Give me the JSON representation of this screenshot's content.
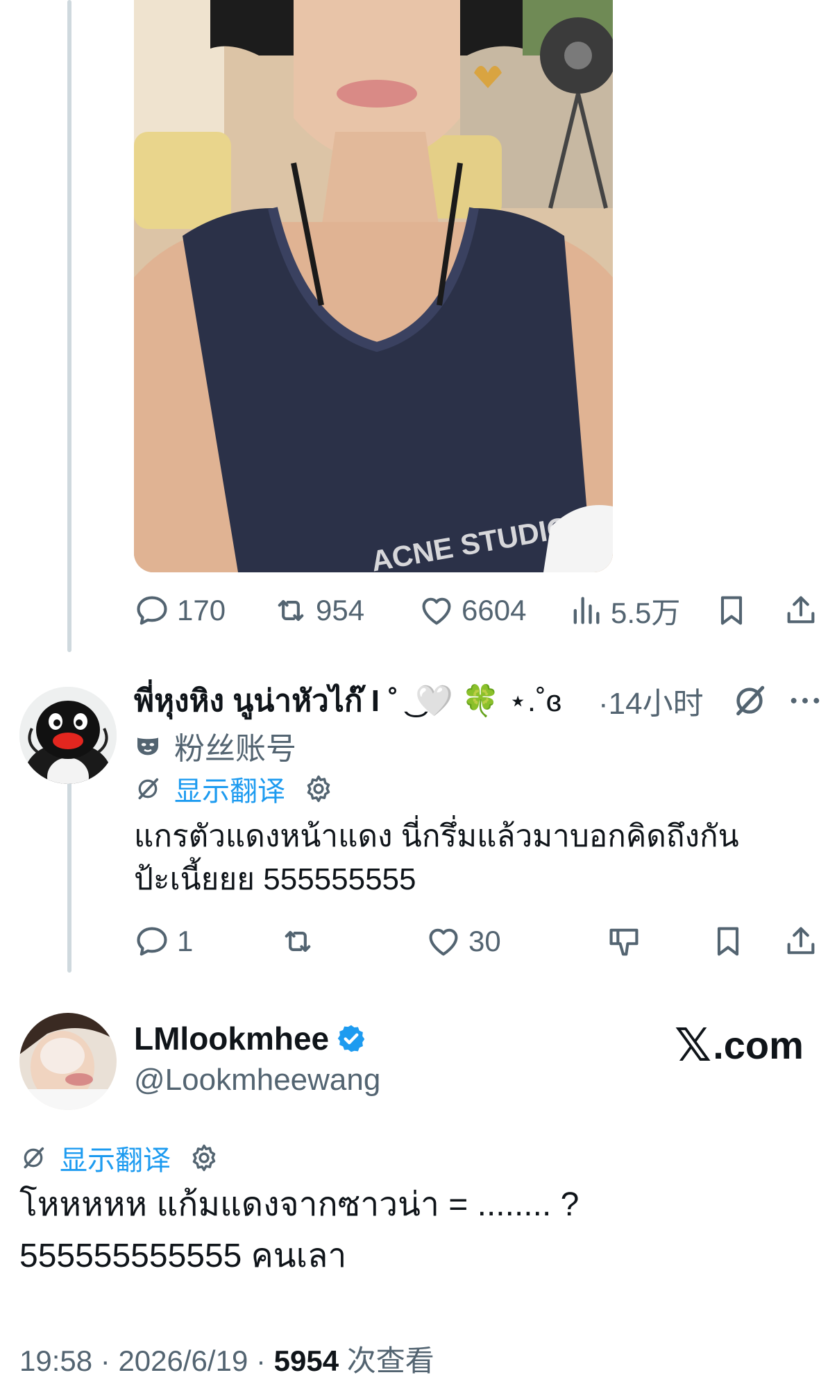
{
  "photo": {
    "shirt_print": "ACNE STUDIOS"
  },
  "first_tweet_actions": {
    "reply_count": "170",
    "retweet_count": "954",
    "like_count": "6604",
    "view_count": "5.5万"
  },
  "reply": {
    "display_name": "พี่หุงหิง นูน่าหัวไก๊ I ˚ ͜",
    "name_decoration": "🤍 🍀 ⋆.˚ɞ",
    "time": "·14小时",
    "fan_badge": "粉丝账号",
    "translate_label": "显示翻译",
    "text_line1": "แกรตัวแดงหน้าแดง นี่กรึ่มแล้วมาบอกคิดถึงกัน",
    "text_line2": "ป้ะเนี้ยยย 555555555",
    "reply_count": "1",
    "like_count": "30"
  },
  "main_tweet": {
    "display_name": "LMlookmhee",
    "handle": "@Lookmheewang",
    "brand_label": ".com",
    "translate_label": "显示翻译",
    "text_line1": "โหหหหห แก้มแดงจากซาวน่า = ........ ?",
    "text_line2": "555555555555 คนเลา",
    "time": "19:58",
    "date": "2026/6/19",
    "views_count": "5954",
    "views_label": "次查看",
    "separator": "·"
  },
  "colors": {
    "accent": "#1d9bf0",
    "secondary_text": "#536471",
    "primary_text": "#0f1419",
    "thread_line": "#cfd9de"
  }
}
